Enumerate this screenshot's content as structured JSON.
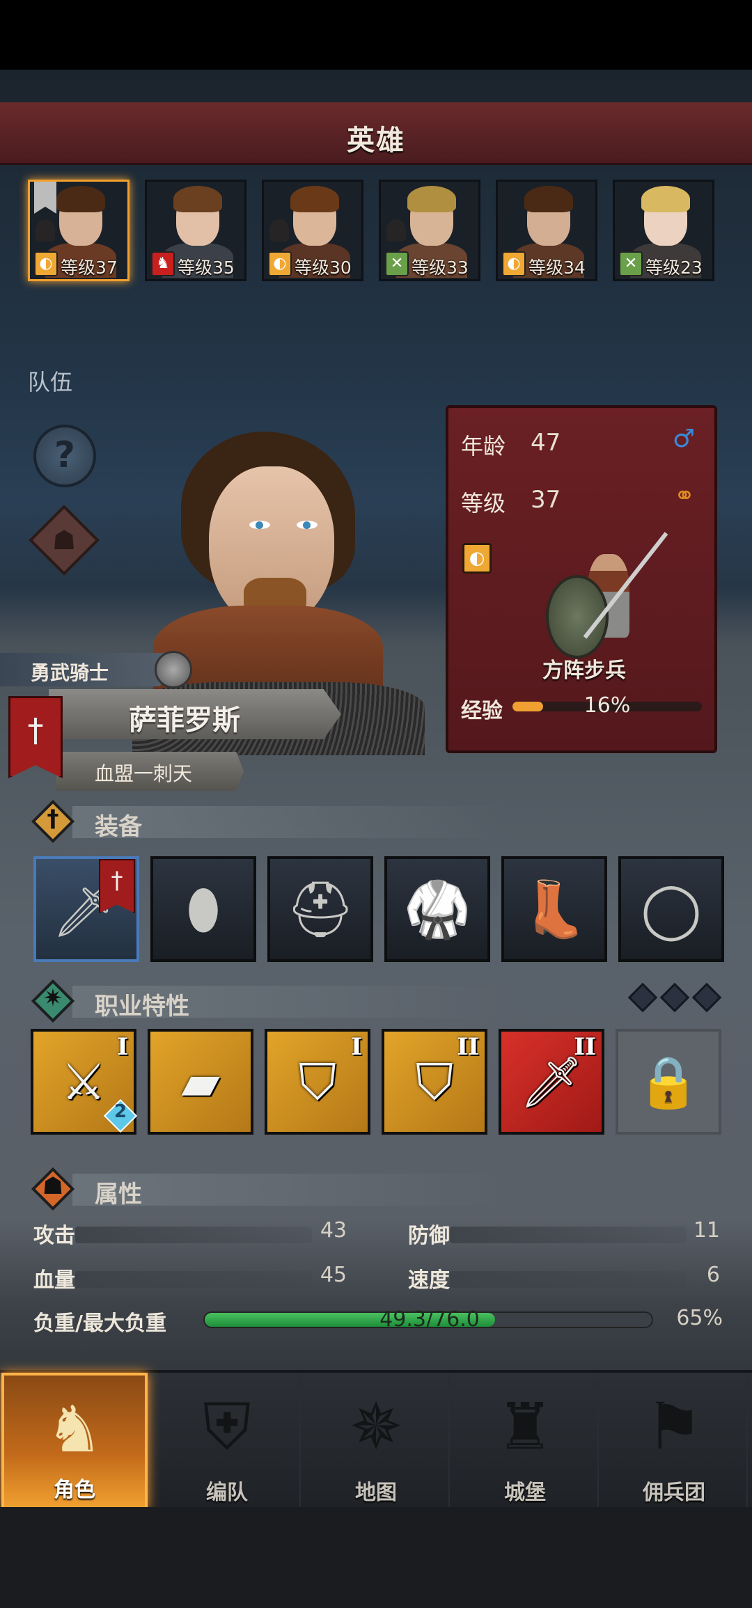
{
  "header": {
    "title": "英雄"
  },
  "roster": [
    {
      "level_text": "等级37",
      "class": "shield",
      "badge_color": "#f0a834",
      "badge_glyph": "◐",
      "hair": "#4a2a14",
      "skin": "#d8b296",
      "body": "#6a3a24",
      "active": true
    },
    {
      "level_text": "等级35",
      "class": "horse",
      "badge_color": "#c8201e",
      "badge_glyph": "♞",
      "hair": "#6a4020",
      "skin": "#e2c0a8",
      "body": "#3c4048",
      "active": false
    },
    {
      "level_text": "等级30",
      "class": "shield",
      "badge_color": "#f0a834",
      "badge_glyph": "◐",
      "hair": "#6a3a18",
      "skin": "#dcb698",
      "body": "#5a3424",
      "active": false
    },
    {
      "level_text": "等级33",
      "class": "bow",
      "badge_color": "#6aa04a",
      "badge_glyph": "✕",
      "hair": "#b09040",
      "skin": "#d8b496",
      "body": "#6a4430",
      "active": false
    },
    {
      "level_text": "等级34",
      "class": "shield",
      "badge_color": "#f0a834",
      "badge_glyph": "◐",
      "hair": "#4a2a14",
      "skin": "#d4ae92",
      "body": "#5e3826",
      "active": false
    },
    {
      "level_text": "等级23",
      "class": "bow",
      "badge_color": "#6aa04a",
      "badge_glyph": "✕",
      "hair": "#d8b860",
      "skin": "#ecd2c0",
      "body": "#3e3a3a",
      "active": false
    }
  ],
  "team_label": "队伍",
  "hero": {
    "title": "勇武骑士",
    "name": "萨菲罗斯",
    "guild": "血盟一刺天",
    "age_label": "年龄",
    "age": "47",
    "level_label": "等级",
    "level": "37",
    "unit_name": "方阵步兵",
    "exp_label": "经验",
    "exp_percent_text": "16%",
    "exp_fraction": 0.16
  },
  "sections": {
    "equipment": "装备",
    "traits": "职业特性",
    "attributes": "属性"
  },
  "equipment": [
    {
      "name": "sword",
      "glyph": "🗡",
      "selected": true
    },
    {
      "name": "shield",
      "glyph": "⬮",
      "selected": false
    },
    {
      "name": "helmet",
      "glyph": "⛑",
      "selected": false
    },
    {
      "name": "armor",
      "glyph": "🥋",
      "selected": false
    },
    {
      "name": "boots",
      "glyph": "👢",
      "selected": false
    },
    {
      "name": "ring",
      "glyph": "◯",
      "selected": false
    }
  ],
  "traits": [
    {
      "name": "sword-cursor",
      "glyph": "⚔",
      "rank": "I",
      "style": "gold",
      "gem": "2"
    },
    {
      "name": "blade",
      "glyph": "▰",
      "rank": "",
      "style": "gold",
      "gem": ""
    },
    {
      "name": "shield-arrow",
      "glyph": "⛉",
      "rank": "I",
      "style": "gold",
      "gem": ""
    },
    {
      "name": "shield",
      "glyph": "⛉",
      "rank": "II",
      "style": "gold",
      "gem": ""
    },
    {
      "name": "sword-red",
      "glyph": "🗡",
      "rank": "II",
      "style": "red",
      "gem": ""
    },
    {
      "name": "lock",
      "glyph": "🔒",
      "rank": "",
      "style": "locked",
      "gem": ""
    }
  ],
  "attributes": {
    "attack_label": "攻击",
    "attack": "43",
    "defense_label": "防御",
    "defense": "11",
    "hp_label": "血量",
    "hp": "45",
    "speed_label": "速度",
    "speed": "6",
    "load_label": "负重/最大负重",
    "load_text": "49.3/76.0",
    "load_fraction": 0.65,
    "load_percent": "65%"
  },
  "nav": [
    {
      "label": "角色",
      "glyph": "♞",
      "active": true
    },
    {
      "label": "编队",
      "glyph": "⛨",
      "active": false
    },
    {
      "label": "地图",
      "glyph": "✵",
      "active": false
    },
    {
      "label": "城堡",
      "glyph": "♜",
      "active": false
    },
    {
      "label": "佣兵团",
      "glyph": "⚑",
      "active": false
    }
  ],
  "colors": {
    "accent": "#f0a030",
    "header_red": "#6a2a2c",
    "panel_red": "#6a2024",
    "load_green": "#2ea84a",
    "male_icon": "#3c88d8",
    "ring_icon": "#e08a20"
  }
}
